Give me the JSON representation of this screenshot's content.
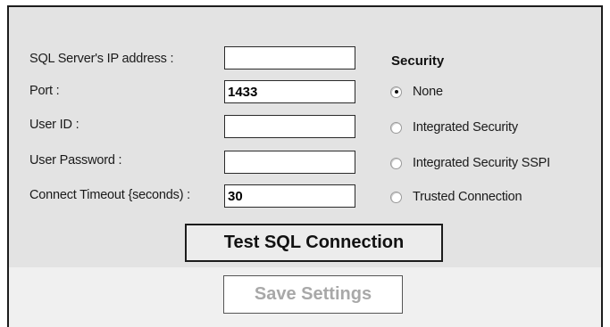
{
  "form": {
    "ip_label": "SQL Server's IP address :",
    "ip_value": "",
    "port_label": "Port :",
    "port_value": "1433",
    "userid_label": "User ID :",
    "userid_value": "",
    "password_label": "User Password :",
    "password_value": "",
    "timeout_label": "Connect Timeout {seconds) :",
    "timeout_value": "30"
  },
  "security": {
    "title": "Security",
    "options": [
      {
        "label": "None",
        "checked": true
      },
      {
        "label": "Integrated Security",
        "checked": false
      },
      {
        "label": "Integrated Security SSPI",
        "checked": false
      },
      {
        "label": "Trusted Connection",
        "checked": false
      }
    ]
  },
  "buttons": {
    "test_label": "Test SQL Connection",
    "save_label": "Save Settings",
    "save_enabled": false
  }
}
